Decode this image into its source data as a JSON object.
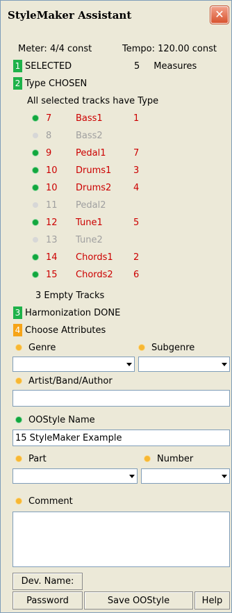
{
  "window": {
    "title": "StyleMaker Assistant",
    "close_glyph": "✕"
  },
  "info": {
    "meter": "Meter:  4/4 const",
    "tempo": "Tempo: 120.00 const"
  },
  "steps": {
    "selected": {
      "num": "1",
      "label": "SELECTED",
      "count": "5",
      "unit": "Measures"
    },
    "type": {
      "num": "2",
      "label": "Type CHOSEN",
      "note": "All selected tracks have Type"
    },
    "harmonization": {
      "num": "3",
      "label": "Harmonization DONE"
    },
    "attributes": {
      "num": "4",
      "label": "Choose Attributes"
    }
  },
  "tracks": [
    {
      "num": "7",
      "name": "Bass1",
      "order": "1",
      "active": true
    },
    {
      "num": "8",
      "name": "Bass2",
      "order": "",
      "active": false
    },
    {
      "num": "9",
      "name": "Pedal1",
      "order": "7",
      "active": true
    },
    {
      "num": "10",
      "name": "Drums1",
      "order": "3",
      "active": true
    },
    {
      "num": "10",
      "name": "Drums2",
      "order": "4",
      "active": true
    },
    {
      "num": "11",
      "name": "Pedal2",
      "order": "",
      "active": false
    },
    {
      "num": "12",
      "name": "Tune1",
      "order": "5",
      "active": true
    },
    {
      "num": "13",
      "name": "Tune2",
      "order": "",
      "active": false
    },
    {
      "num": "14",
      "name": "Chords1",
      "order": "2",
      "active": true
    },
    {
      "num": "15",
      "name": "Chords2",
      "order": "6",
      "active": true
    }
  ],
  "empty_tracks": "3 Empty Tracks",
  "form": {
    "genre_label": "Genre",
    "genre_value": "",
    "subgenre_label": "Subgenre",
    "subgenre_value": "",
    "artist_label": "Artist/Band/Author",
    "artist_value": "",
    "style_name_label": "OOStyle Name",
    "style_name_value": "15 StyleMaker Example",
    "part_label": "Part",
    "part_value": "",
    "number_label": "Number",
    "number_value": "",
    "comment_label": "Comment",
    "comment_value": ""
  },
  "buttons": {
    "dev_name": "Dev. Name:",
    "password": "Password",
    "save": "Save OOStyle",
    "help": "Help"
  },
  "colors": {
    "step_green": "#1fb24a",
    "step_orange": "#f6a418",
    "track_red": "#cc0000",
    "disabled_grey": "#a0a0a0"
  }
}
